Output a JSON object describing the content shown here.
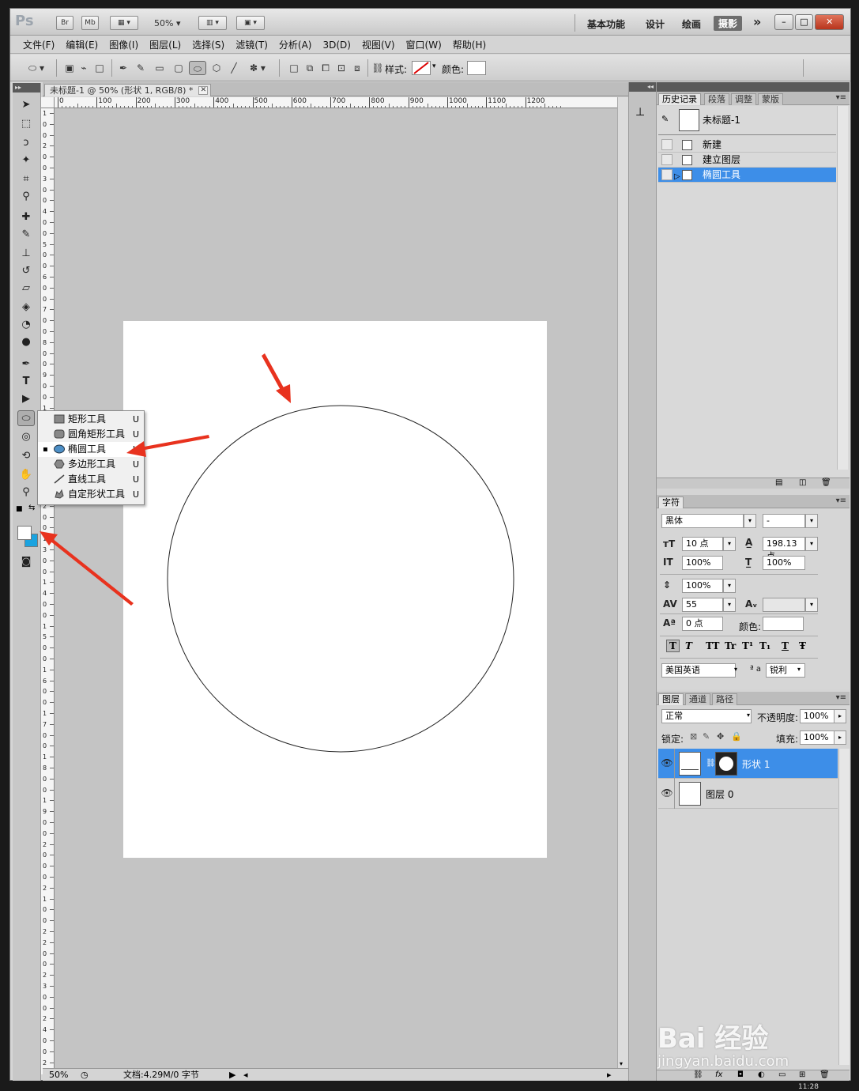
{
  "app": {
    "logo": "Ps",
    "buttons": [
      "Br",
      "Mb"
    ],
    "zoom": "50%",
    "workspaces": [
      "基本功能",
      "设计",
      "绘画",
      "摄影"
    ],
    "active_workspace": "摄影",
    "more": "»",
    "window_controls": [
      "–",
      "□",
      "✕"
    ]
  },
  "menu": [
    "文件(F)",
    "编辑(E)",
    "图像(I)",
    "图层(L)",
    "选择(S)",
    "滤镜(T)",
    "分析(A)",
    "3D(D)",
    "视图(V)",
    "窗口(W)",
    "帮助(H)"
  ],
  "options": {
    "style_label": "样式:",
    "color_label": "颜色:"
  },
  "document": {
    "tab_title": "未标题-1 @ 50% (形状 1, RGB/8) *",
    "tab_close": "✕",
    "ruler_top": [
      "0",
      "100",
      "200",
      "300",
      "400",
      "500",
      "600",
      "700",
      "800",
      "900",
      "1000",
      "1100",
      "1200"
    ],
    "ruler_left": [
      "1",
      "0",
      "0",
      "2",
      "0",
      "0",
      "3",
      "0",
      "0",
      "4",
      "0",
      "0",
      "5",
      "0",
      "0",
      "6",
      "0",
      "0",
      "7",
      "0",
      "0",
      "8",
      "0",
      "0",
      "9",
      "0",
      "0",
      "1",
      "0",
      "0",
      "0",
      "1",
      "1",
      "0",
      "0",
      "1",
      "2",
      "0",
      "0",
      "1",
      "3",
      "0",
      "0",
      "1",
      "4",
      "0",
      "0",
      "1",
      "5",
      "0",
      "0",
      "1",
      "6",
      "0",
      "0",
      "1",
      "7",
      "0",
      "0",
      "1",
      "8",
      "0",
      "0",
      "1",
      "9",
      "0",
      "0",
      "2",
      "0",
      "0",
      "0",
      "2",
      "1",
      "0",
      "0",
      "2",
      "2",
      "0",
      "0",
      "2",
      "3",
      "0",
      "0",
      "2",
      "4",
      "0",
      "0",
      "2",
      "5",
      "0",
      "0",
      "2",
      "6",
      "0",
      "0"
    ]
  },
  "status": {
    "zoom": "50%",
    "doc_info": "文档:4.29M/0 字节"
  },
  "flyout": {
    "items": [
      {
        "label": "矩形工具",
        "key": "U",
        "icon": "rectangle-icon",
        "selected": false
      },
      {
        "label": "圆角矩形工具",
        "key": "U",
        "icon": "rounded-rectangle-icon",
        "selected": false
      },
      {
        "label": "椭圆工具",
        "key": "U",
        "icon": "ellipse-icon",
        "selected": true
      },
      {
        "label": "多边形工具",
        "key": "U",
        "icon": "polygon-icon",
        "selected": false
      },
      {
        "label": "直线工具",
        "key": "U",
        "icon": "line-icon",
        "selected": false
      },
      {
        "label": "自定形状工具",
        "key": "U",
        "icon": "custom-shape-icon",
        "selected": false
      }
    ],
    "bullet": "▪"
  },
  "colors": {
    "foreground": "#ffffff",
    "background": "#1aa3e0",
    "selection": "#3d8ee8",
    "arrow": "#e8321e"
  },
  "history": {
    "tabs": [
      "历史记录",
      "段落",
      "调整",
      "蒙版"
    ],
    "snapshot": "未标题-1",
    "states": [
      "新建",
      "建立图层",
      "椭圆工具"
    ],
    "selected_state": "椭圆工具"
  },
  "character": {
    "tab": "字符",
    "font_family": "黑体",
    "font_style": "-",
    "font_size": "10 点",
    "leading": "198.13 点",
    "vertical_scale": "100%",
    "horizontal_scale": "100%",
    "tracking_scale": "100%",
    "kerning": "55",
    "baseline_shift": "0 点",
    "color_label": "颜色:",
    "style_buttons": [
      "T",
      "T",
      "TT",
      "Tr",
      "T¹",
      "T₁",
      "T",
      "Ŧ"
    ],
    "language": "美国英语",
    "aa_prefix": "ª a",
    "antialias": "锐利"
  },
  "layers": {
    "tabs": [
      "图层",
      "通道",
      "路径"
    ],
    "blend_mode": "正常",
    "opacity_label": "不透明度:",
    "opacity": "100%",
    "lock_label": "锁定:",
    "fill_label": "填充:",
    "fill": "100%",
    "items": [
      {
        "name": "形状 1",
        "selected": true
      },
      {
        "name": "图层 0",
        "selected": false
      }
    ]
  },
  "watermark": {
    "brand": "Bai 经验",
    "url": "jingyan.baidu.com"
  },
  "taskbar": {
    "time": "11:28"
  }
}
